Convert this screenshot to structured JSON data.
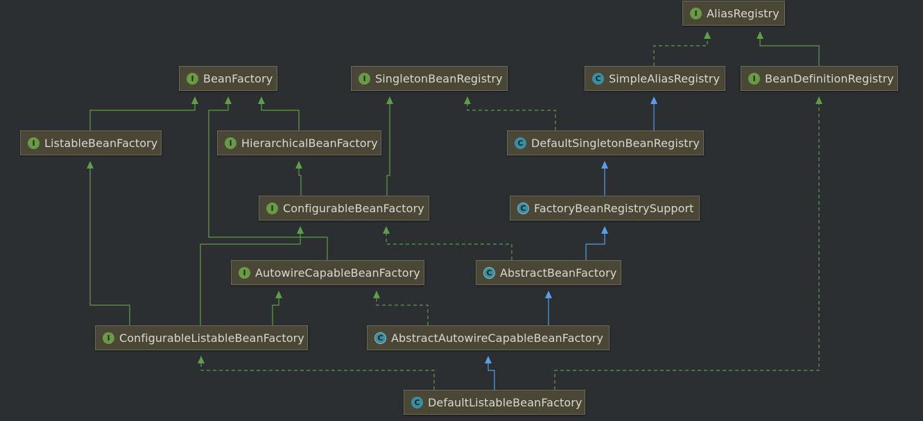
{
  "colors": {
    "background": "#2b2f31",
    "interface_edge": "#5f9e48",
    "class_edge": "#5c9de6",
    "interface_badge": "#6a9a46",
    "class_badge": "#3a8ea2"
  },
  "nodes": [
    {
      "id": "alias-registry",
      "label": "AliasRegistry",
      "kind": "interface",
      "badge": "I"
    },
    {
      "id": "bean-factory",
      "label": "BeanFactory",
      "kind": "interface",
      "badge": "I"
    },
    {
      "id": "singleton-bean-registry",
      "label": "SingletonBeanRegistry",
      "kind": "interface",
      "badge": "I"
    },
    {
      "id": "simple-alias-registry",
      "label": "SimpleAliasRegistry",
      "kind": "class",
      "badge": "C"
    },
    {
      "id": "bean-definition-registry",
      "label": "BeanDefinitionRegistry",
      "kind": "interface",
      "badge": "I"
    },
    {
      "id": "listable-bean-factory",
      "label": "ListableBeanFactory",
      "kind": "interface",
      "badge": "I"
    },
    {
      "id": "hierarchical-bean-factory",
      "label": "HierarchicalBeanFactory",
      "kind": "interface",
      "badge": "I"
    },
    {
      "id": "default-singleton-bean-registry",
      "label": "DefaultSingletonBeanRegistry",
      "kind": "class",
      "badge": "C"
    },
    {
      "id": "configurable-bean-factory",
      "label": "ConfigurableBeanFactory",
      "kind": "interface",
      "badge": "I"
    },
    {
      "id": "factory-bean-registry-support",
      "label": "FactoryBeanRegistrySupport",
      "kind": "abstract",
      "badge": "C"
    },
    {
      "id": "autowire-capable-bean-factory",
      "label": "AutowireCapableBeanFactory",
      "kind": "interface",
      "badge": "I"
    },
    {
      "id": "abstract-bean-factory",
      "label": "AbstractBeanFactory",
      "kind": "abstract",
      "badge": "C"
    },
    {
      "id": "configurable-listable-bean-factory",
      "label": "ConfigurableListableBeanFactory",
      "kind": "interface",
      "badge": "I"
    },
    {
      "id": "abstract-autowire-capable-bean-factory",
      "label": "AbstractAutowireCapableBeanFactory",
      "kind": "abstract",
      "badge": "C"
    },
    {
      "id": "default-listable-bean-factory",
      "label": "DefaultListableBeanFactory",
      "kind": "class",
      "badge": "C"
    }
  ],
  "edges": [
    {
      "from": "simple-alias-registry",
      "to": "alias-registry",
      "type": "implements"
    },
    {
      "from": "bean-definition-registry",
      "to": "alias-registry",
      "type": "extends-interface"
    },
    {
      "from": "listable-bean-factory",
      "to": "bean-factory",
      "type": "extends-interface"
    },
    {
      "from": "hierarchical-bean-factory",
      "to": "bean-factory",
      "type": "extends-interface"
    },
    {
      "from": "autowire-capable-bean-factory",
      "to": "bean-factory",
      "type": "extends-interface"
    },
    {
      "from": "default-singleton-bean-registry",
      "to": "singleton-bean-registry",
      "type": "implements"
    },
    {
      "from": "default-singleton-bean-registry",
      "to": "simple-alias-registry",
      "type": "extends"
    },
    {
      "from": "configurable-bean-factory",
      "to": "hierarchical-bean-factory",
      "type": "extends-interface"
    },
    {
      "from": "configurable-bean-factory",
      "to": "singleton-bean-registry",
      "type": "extends-interface"
    },
    {
      "from": "factory-bean-registry-support",
      "to": "default-singleton-bean-registry",
      "type": "extends"
    },
    {
      "from": "abstract-bean-factory",
      "to": "configurable-bean-factory",
      "type": "implements"
    },
    {
      "from": "abstract-bean-factory",
      "to": "factory-bean-registry-support",
      "type": "extends"
    },
    {
      "from": "configurable-listable-bean-factory",
      "to": "listable-bean-factory",
      "type": "extends-interface"
    },
    {
      "from": "configurable-listable-bean-factory",
      "to": "configurable-bean-factory",
      "type": "extends-interface"
    },
    {
      "from": "configurable-listable-bean-factory",
      "to": "autowire-capable-bean-factory",
      "type": "extends-interface"
    },
    {
      "from": "abstract-autowire-capable-bean-factory",
      "to": "autowire-capable-bean-factory",
      "type": "implements"
    },
    {
      "from": "abstract-autowire-capable-bean-factory",
      "to": "abstract-bean-factory",
      "type": "extends"
    },
    {
      "from": "default-listable-bean-factory",
      "to": "configurable-listable-bean-factory",
      "type": "implements"
    },
    {
      "from": "default-listable-bean-factory",
      "to": "abstract-autowire-capable-bean-factory",
      "type": "extends"
    },
    {
      "from": "default-listable-bean-factory",
      "to": "bean-definition-registry",
      "type": "implements"
    }
  ]
}
